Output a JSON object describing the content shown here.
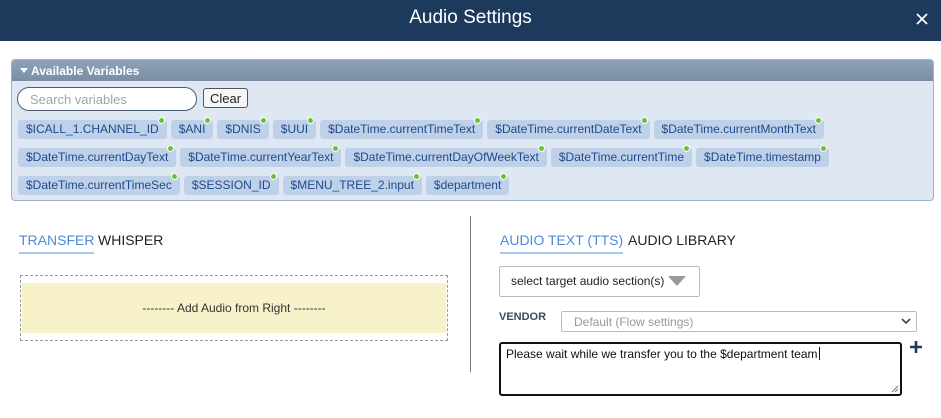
{
  "dialog": {
    "title": "Audio Settings"
  },
  "variables_panel": {
    "header": "Available Variables",
    "search_placeholder": "Search variables",
    "clear_label": "Clear",
    "rows": [
      [
        {
          "label": "$ICALL_1.CHANNEL_ID",
          "dot": true
        },
        {
          "label": "$ANI",
          "dot": true
        },
        {
          "label": "$DNIS",
          "dot": true
        },
        {
          "label": "$UUI",
          "dot": true
        },
        {
          "label": "$DateTime.currentTimeText",
          "dot": true
        },
        {
          "label": "$DateTime.currentDateText",
          "dot": true
        },
        {
          "label": "$DateTime.currentMonthText",
          "dot": true
        }
      ],
      [
        {
          "label": "$DateTime.currentDayText",
          "dot": true
        },
        {
          "label": "$DateTime.currentYearText",
          "dot": true
        },
        {
          "label": "$DateTime.currentDayOfWeekText",
          "dot": true
        },
        {
          "label": "$DateTime.currentTime",
          "dot": true
        },
        {
          "label": "$DateTime.timestamp",
          "dot": true
        }
      ],
      [
        {
          "label": "$DateTime.currentTimeSec",
          "dot": true
        },
        {
          "label": "$SESSION_ID",
          "dot": true
        },
        {
          "label": "$MENU_TREE_2.input",
          "dot": true
        },
        {
          "label": "$department",
          "dot": true
        }
      ]
    ]
  },
  "left_tabs": [
    {
      "label": "TRANSFER",
      "active": true
    },
    {
      "label": "WHISPER",
      "active": false
    }
  ],
  "audio_drop": {
    "label": "-------- Add Audio from Right --------"
  },
  "right_tabs": [
    {
      "label": "AUDIO TEXT (TTS)",
      "active": true
    },
    {
      "label": "AUDIO LIBRARY",
      "active": false
    }
  ],
  "section_select": {
    "label": "select target audio section(s)"
  },
  "vendor": {
    "label": "VENDOR",
    "value": "Default (Flow settings)"
  },
  "tts": {
    "text": "Please wait while we transfer you to the  $department team"
  },
  "colors": {
    "titlebar": "#1d3a5c",
    "chip_bg": "#bfd0e9",
    "chip_text": "#1e4a8a",
    "chip_dot": "#6cbf3a",
    "active_tab": "#4e8ad6",
    "drop_bg": "#f8f2cb"
  }
}
